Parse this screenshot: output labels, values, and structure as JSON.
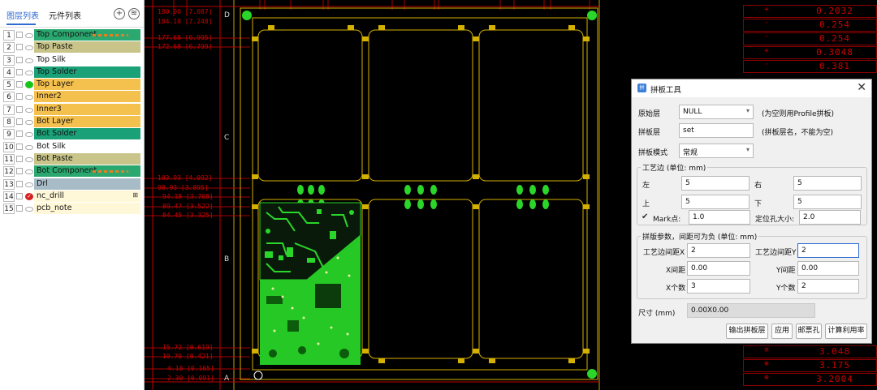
{
  "panel": {
    "tab_layers": "图层列表",
    "tab_components": "元件列表",
    "add_icon": "+",
    "stack_icon": "≋"
  },
  "layers": [
    {
      "num": "1",
      "name": "Top Component",
      "color": "#2aa870",
      "vis": "eye"
    },
    {
      "num": "2",
      "name": "Top Paste",
      "color": "#c8c48a",
      "vis": "eye"
    },
    {
      "num": "3",
      "name": "Top Silk",
      "color": "#ffffff",
      "vis": "eye"
    },
    {
      "num": "4",
      "name": "Top Solder",
      "color": "#1aa178",
      "vis": "eye"
    },
    {
      "num": "5",
      "name": "Top Layer",
      "color": "#f5c14e",
      "vis": "green-dot"
    },
    {
      "num": "6",
      "name": "Inner2",
      "color": "#f5c14e",
      "vis": "eye"
    },
    {
      "num": "7",
      "name": "Inner3",
      "color": "#f5c14e",
      "vis": "eye"
    },
    {
      "num": "8",
      "name": "Bot Layer",
      "color": "#f5c14e",
      "vis": "eye"
    },
    {
      "num": "9",
      "name": "Bot Solder",
      "color": "#1aa178",
      "vis": "eye"
    },
    {
      "num": "10",
      "name": "Bot Silk",
      "color": "#ffffff",
      "vis": "eye"
    },
    {
      "num": "11",
      "name": "Bot Paste",
      "color": "#c8c48a",
      "vis": "eye"
    },
    {
      "num": "12",
      "name": "Bot Component",
      "color": "#2aa870",
      "vis": "eye"
    },
    {
      "num": "13",
      "name": "Drl",
      "color": "#a8bcc8",
      "vis": "eye"
    },
    {
      "num": "14",
      "name": "nc_drill",
      "color": "#fff8d8",
      "vis": "red-check",
      "extra": "⊞"
    },
    {
      "num": "15",
      "name": "pcb_note",
      "color": "#fff8d8",
      "vis": "eye"
    }
  ],
  "canvas": {
    "row_letters": [
      "D",
      "C",
      "B",
      "A"
    ],
    "coords": [
      "180.00 [7.087]",
      "184.10 [7.248]",
      "177.68 [6.995]",
      "172.68 [6.799]",
      "103.93 [4.092]",
      "98.93 [3.895]",
      "94.18 [3.708]",
      "89.47 [3.522]",
      "84.45 [3.325]",
      "15.72 [0.619]",
      "10.70 [0.421]",
      "4.18 [0.165]",
      "2.30 [0.091]"
    ]
  },
  "drill_table": {
    "top": [
      {
        "sym": "+",
        "val": "0.2032"
      },
      {
        "sym": "·",
        "val": "0.254"
      },
      {
        "sym": "·",
        "val": "0.254"
      },
      {
        "sym": "+",
        "val": "0.3048"
      },
      {
        "sym": "·",
        "val": "0.381"
      }
    ],
    "bottom": [
      {
        "sym": "≡",
        "val": "3.048"
      },
      {
        "sym": "⊕",
        "val": "3.175"
      },
      {
        "sym": "⊕",
        "val": "3.2004"
      }
    ]
  },
  "dialog": {
    "title": "拼板工具",
    "icon_text": "拼",
    "close": "✕",
    "source_layer_label": "原始层",
    "source_layer_value": "NULL",
    "source_layer_hint": "(为空则用Profile拼板)",
    "panel_layer_label": "拼板层",
    "panel_layer_value": "set",
    "panel_layer_hint": "(拼板层名，不能为空)",
    "mode_label": "拼板模式",
    "mode_value": "常规",
    "edge_group_title": "工艺边 (单位: mm)",
    "left_label": "左",
    "left_value": "5",
    "right_label": "右",
    "right_value": "5",
    "top_label": "上",
    "top_value": "5",
    "bottom_label": "下",
    "bottom_value": "5",
    "mark_label": "Mark点:",
    "mark_value": "1.0",
    "hole_label": "定位孔大小:",
    "hole_value": "2.0",
    "params_group_title": "拼版参数，间距可为负 (单位: mm)",
    "edge_gap_x_label": "工艺边间距X",
    "edge_gap_x_value": "2",
    "edge_gap_y_label": "工艺边间距Y",
    "edge_gap_y_value": "2",
    "x_gap_label": "X间距",
    "x_gap_value": "0.00",
    "y_gap_label": "Y间距",
    "y_gap_value": "0.00",
    "x_count_label": "X个数",
    "x_count_value": "3",
    "y_count_label": "Y个数",
    "y_count_value": "2",
    "size_label": "尺寸 (mm)",
    "size_value": "0.00X0.00",
    "btn_output": "输出拼板层",
    "btn_apply": "应用",
    "btn_stamp": "邮票孔",
    "btn_calc": "计算利用率"
  }
}
